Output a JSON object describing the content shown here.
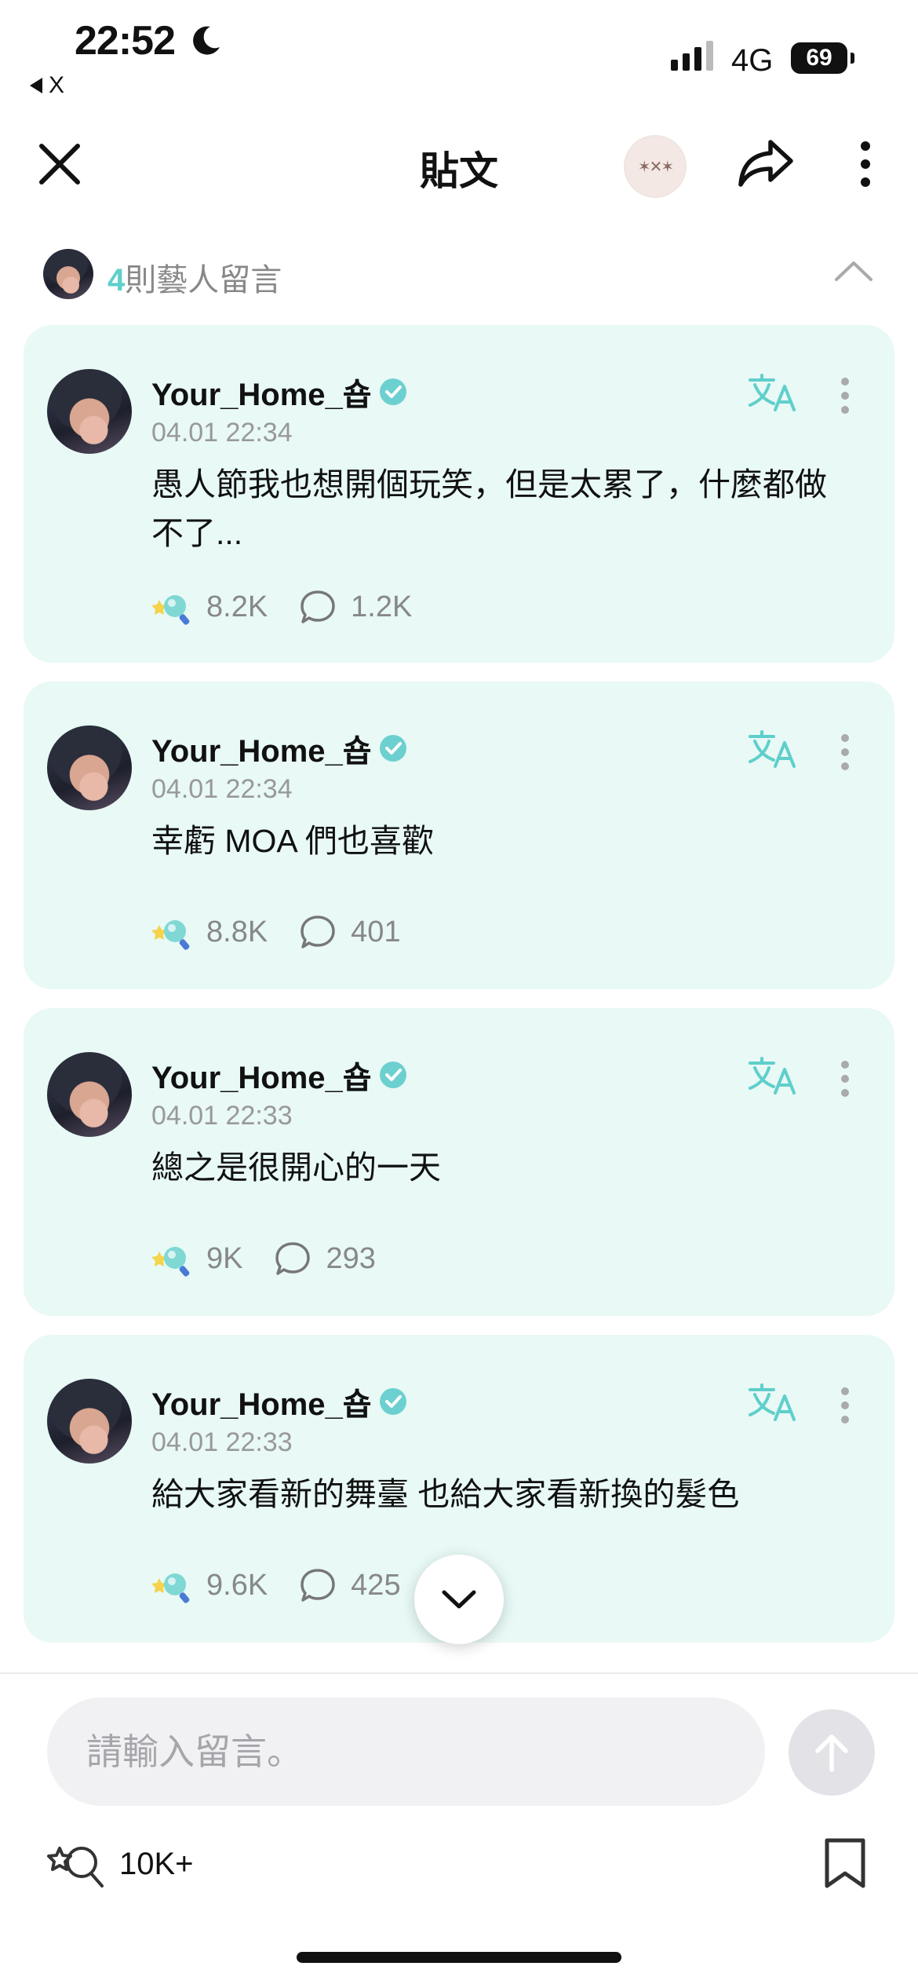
{
  "status_bar": {
    "time": "22:52",
    "back_app": "X",
    "network": "4G",
    "battery": "69"
  },
  "header": {
    "title": "貼文",
    "community_badge": "✶✕✶"
  },
  "artist_comments": {
    "count": "4",
    "label": "則藝人留言"
  },
  "comments": [
    {
      "name": "Your_Home_숍",
      "date": "04.01 22:34",
      "text": "愚人節我也想開個玩笑，但是太累了，什麼都做不了...",
      "lightsticks": "8.2K",
      "replies": "1.2K"
    },
    {
      "name": "Your_Home_숍",
      "date": "04.01 22:34",
      "text": "幸虧 MOA 們也喜歡",
      "lightsticks": "8.8K",
      "replies": "401"
    },
    {
      "name": "Your_Home_숍",
      "date": "04.01 22:33",
      "text": "總之是很開心的一天",
      "lightsticks": "9K",
      "replies": "293"
    },
    {
      "name": "Your_Home_숍",
      "date": "04.01 22:33",
      "text": "給大家看新的舞臺 也給大家看新換的髮色",
      "lightsticks": "9.6K",
      "replies": "425"
    }
  ],
  "input": {
    "placeholder": "請輸入留言。"
  },
  "footer": {
    "cheer_count": "10K+"
  },
  "colors": {
    "accent": "#5fcfcb",
    "card_bg": "#e8f9f6",
    "verified": "#6dd0d0"
  }
}
